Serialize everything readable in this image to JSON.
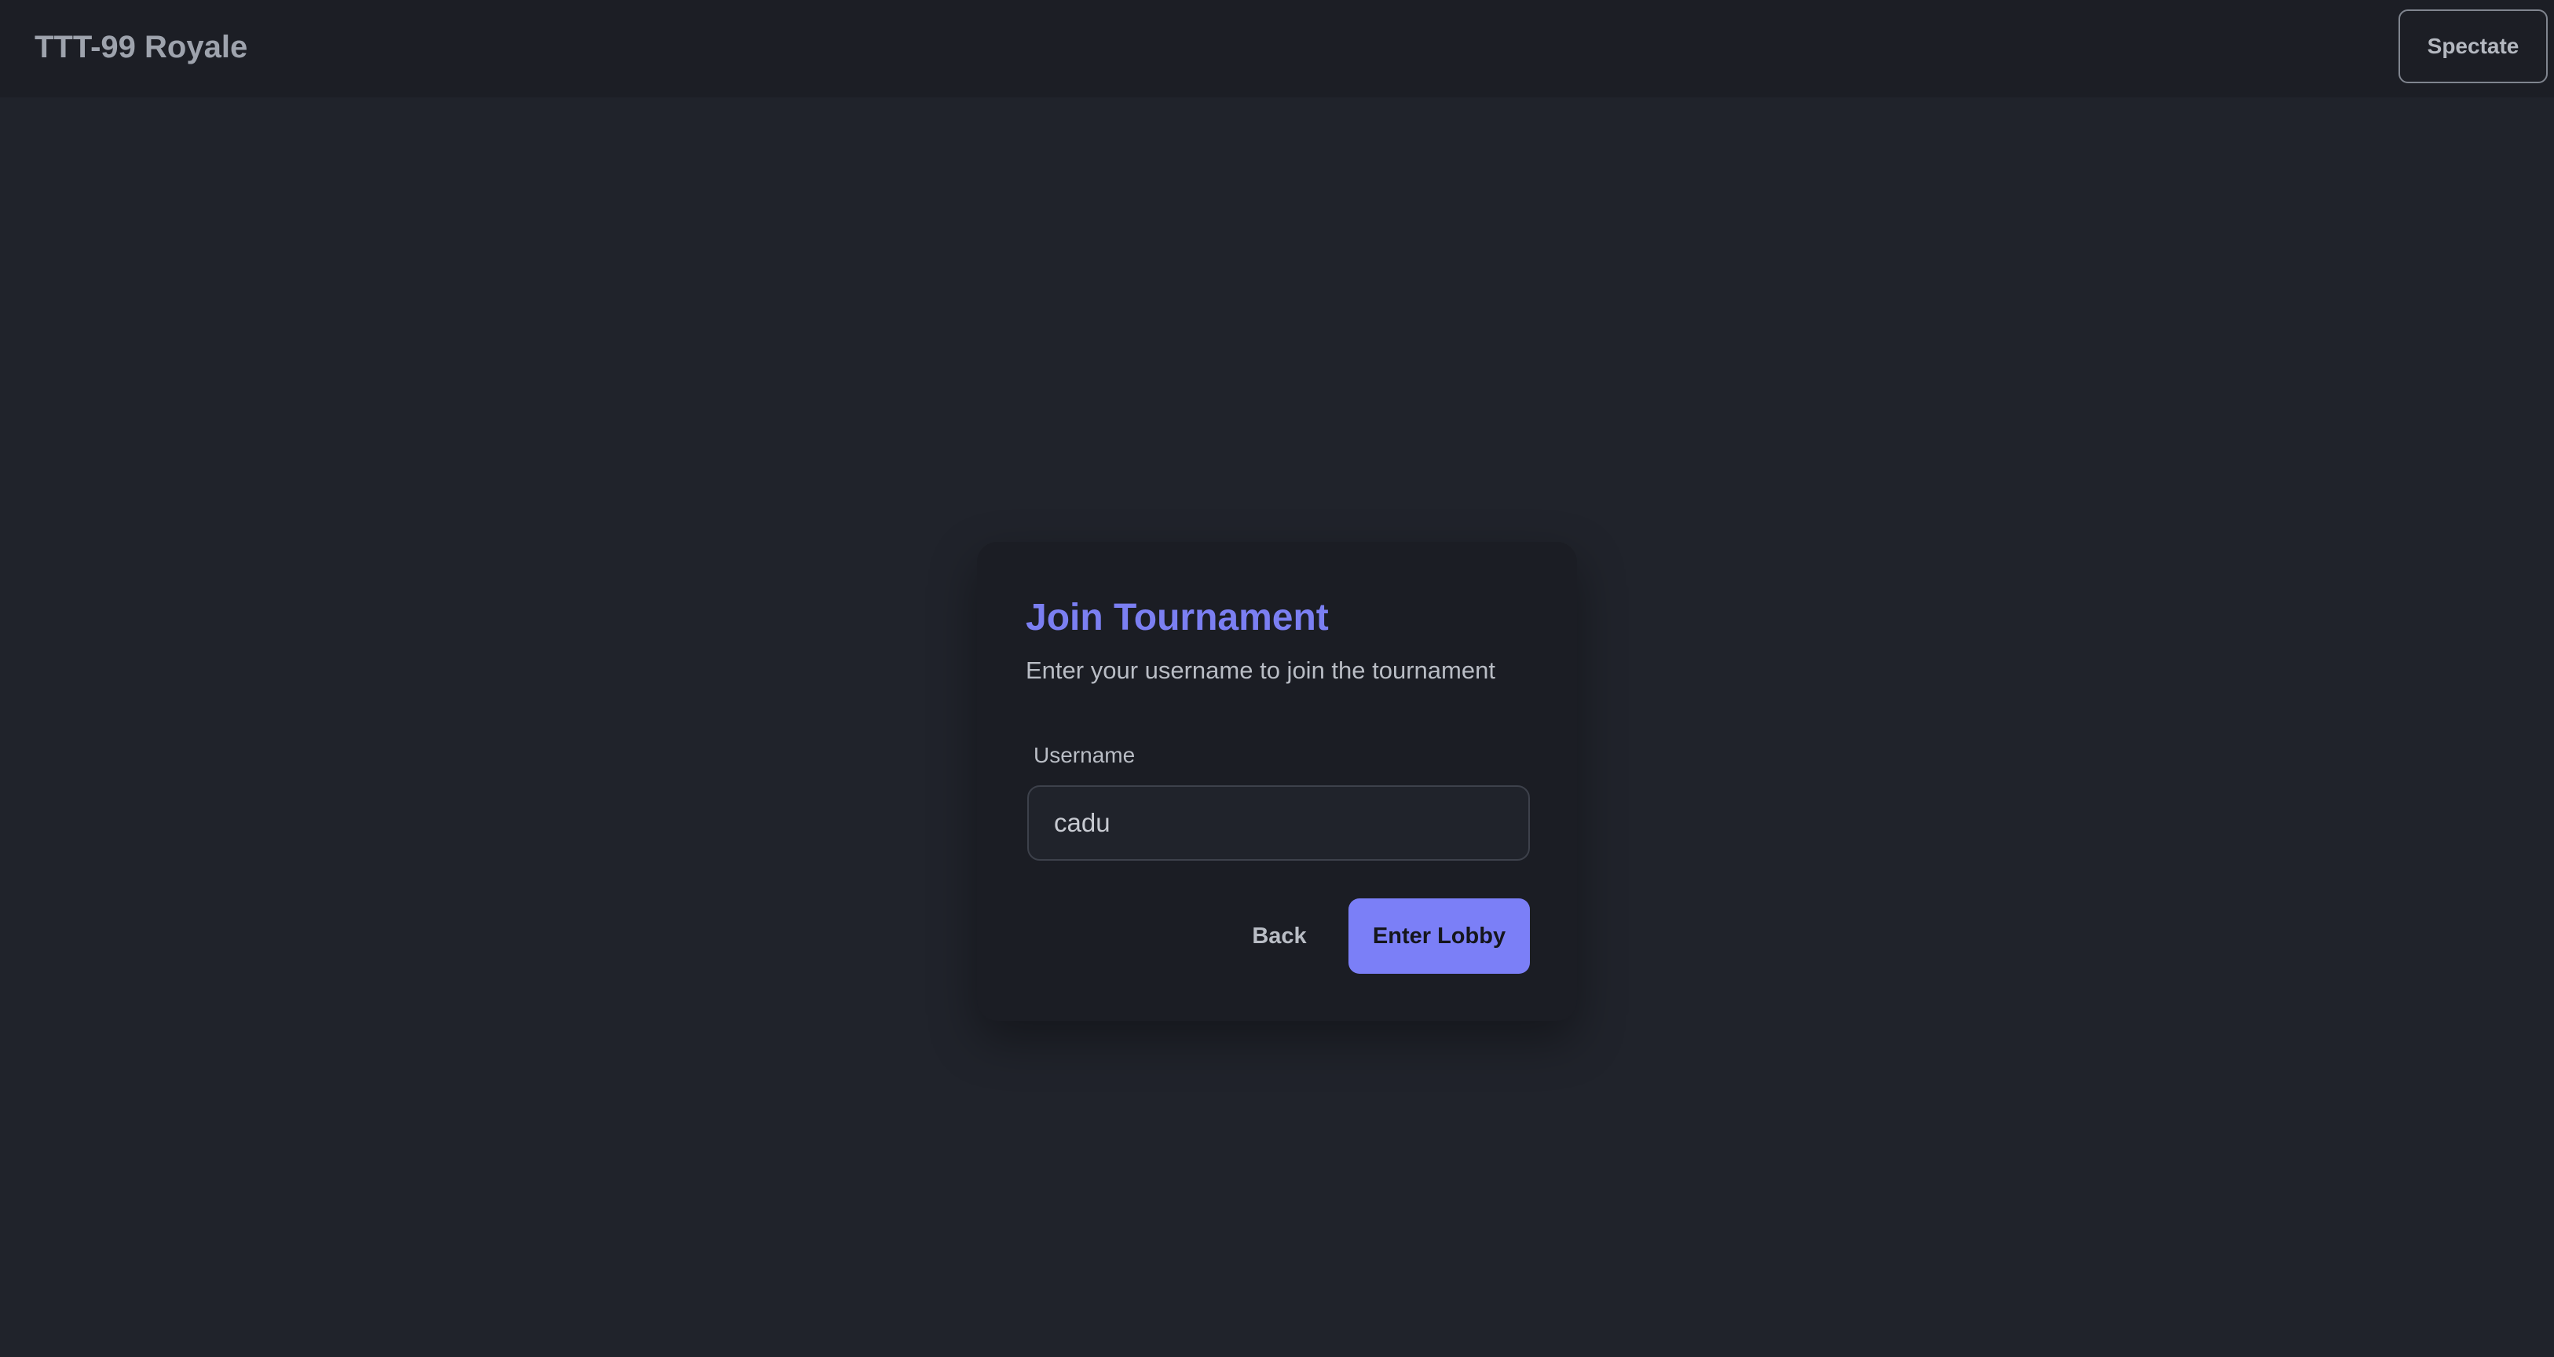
{
  "header": {
    "app_title": "TTT-99 Royale",
    "spectate_label": "Spectate"
  },
  "join_card": {
    "title": "Join Tournament",
    "subtitle": "Enter your username to join the tournament",
    "username_label": "Username",
    "username_value": "cadu",
    "back_label": "Back",
    "enter_label": "Enter Lobby"
  },
  "colors": {
    "accent": "#7b7ff7",
    "background": "#20232b",
    "card": "#1b1d24",
    "topbar": "#1c1e25"
  }
}
